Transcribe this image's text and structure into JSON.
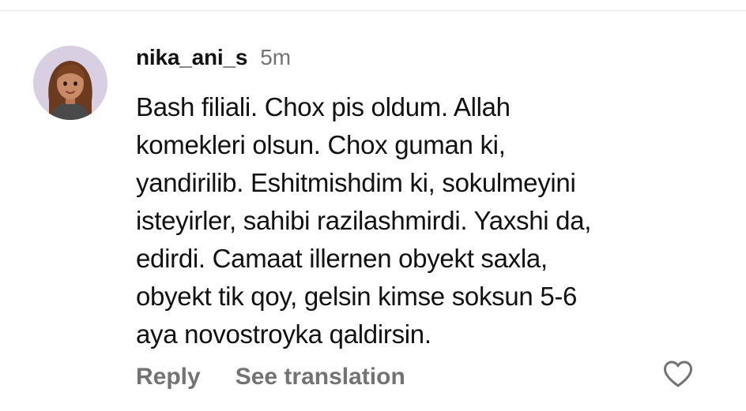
{
  "comment": {
    "username": "nika_ani_s",
    "time": "5m",
    "text_lines": [
      "Bash filiali. Chox pis oldum. Allah",
      "komekleri olsun. Chox guman ki,",
      "yandirilib. Eshitmishdim ki, sokulmeyini",
      "isteyirler, sahibi razilashmirdi. Yaxshi da,",
      "edirdi. Camaat illernen obyekt saxla,",
      "obyekt tik qoy, gelsin kimse soksun 5-6",
      "aya novostroyka qaldirsin."
    ],
    "actions": {
      "reply_label": "Reply",
      "translate_label": "See translation"
    },
    "icons": {
      "avatar": "avatar-icon",
      "like": "heart-outline-icon"
    }
  },
  "colors": {
    "text": "#111111",
    "secondary": "#737373",
    "avatar_bg": "#d9cfe3",
    "divider": "#e6e6e6"
  }
}
